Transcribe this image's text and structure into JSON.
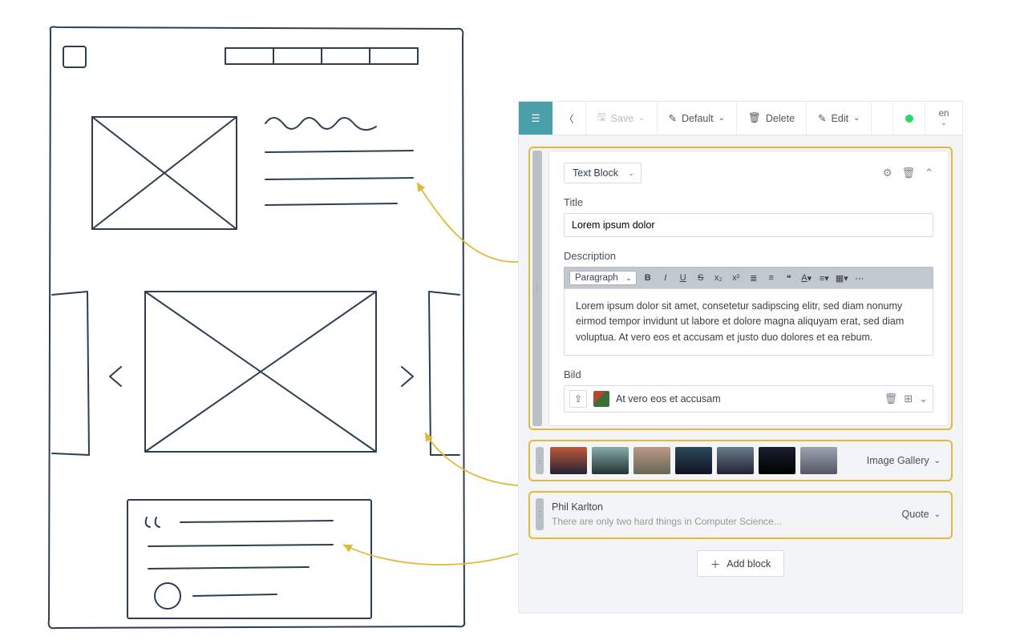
{
  "toolbar": {
    "save_label": "Save",
    "default_label": "Default",
    "delete_label": "Delete",
    "edit_label": "Edit",
    "lang": "en"
  },
  "text_block": {
    "type_label": "Text Block",
    "title_label": "Title",
    "title_value": "Lorem ipsum dolor",
    "description_label": "Description",
    "rte": {
      "paragraph_label": "Paragraph",
      "body": "Lorem ipsum dolor sit amet, consetetur sadipscing elitr, sed diam nonumy eirmod tempor invidunt ut labore et dolore magna aliquyam erat, sed diam voluptua. At vero eos et accusam et justo duo dolores et ea rebum."
    },
    "bild_label": "Bild",
    "bild_title": "At vero eos et accusam"
  },
  "gallery": {
    "label": "Image Gallery"
  },
  "quote": {
    "author": "Phil Karlton",
    "text": "There are only two hard things in Computer Science...",
    "label": "Quote"
  },
  "add_block_label": "Add block"
}
